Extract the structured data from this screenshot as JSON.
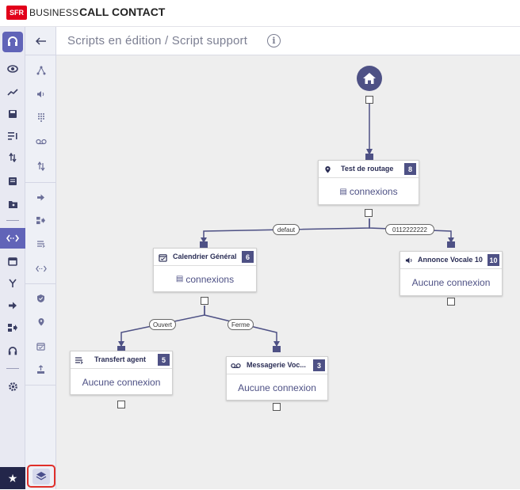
{
  "app": {
    "logo_text": "SFR",
    "brand_text": "BUSINESS",
    "title": "CALL CONTACT"
  },
  "header": {
    "breadcrumb": "Scripts en édition / Script support",
    "info_icon": "info-icon"
  },
  "palette": {
    "back_icon": "arrow-left-icon"
  },
  "nodes": [
    {
      "id": "test-de-routage",
      "icon": "location-pin-icon",
      "title": "Test de routage",
      "badge": "8",
      "body": "connexions",
      "body_icon": "list-icon"
    },
    {
      "id": "calendrier-general",
      "icon": "calendar-check-icon",
      "title": "Calendrier Général",
      "badge": "6",
      "body": "connexions",
      "body_icon": "list-icon"
    },
    {
      "id": "annonce-vocale-10",
      "icon": "speaker-icon",
      "title": "Annonce Vocale 10",
      "badge": "10",
      "body": "Aucune connexion"
    },
    {
      "id": "transfert-agent",
      "icon": "transfer-icon",
      "title": "Transfert agent",
      "badge": "5",
      "body": "Aucune connexion"
    },
    {
      "id": "messagerie-vocale",
      "icon": "voicemail-icon",
      "title": "Messagerie Voc...",
      "badge": "3",
      "body": "Aucune connexion"
    }
  ],
  "edges": [
    {
      "label": "defaut"
    },
    {
      "label": "0112222222"
    },
    {
      "label": "Ouvert"
    },
    {
      "label": "Ferme"
    }
  ],
  "colors": {
    "accent": "#4e5185",
    "rail_active": "#6164b8",
    "brand_red": "#e2001a",
    "highlight_red": "#e0302a"
  }
}
